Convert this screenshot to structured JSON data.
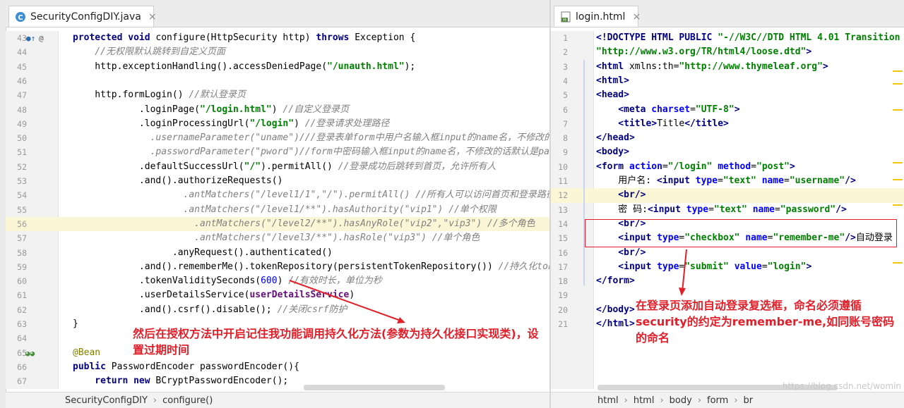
{
  "left_pane": {
    "tab": {
      "label": "SecurityConfigDIY.java",
      "close": "×"
    },
    "breadcrumb": [
      "SecurityConfigDIY",
      "configure()"
    ],
    "lines": [
      {
        "n": "43",
        "tokens": [
          [
            "kw",
            "protected void "
          ],
          [
            "",
            "configure(HttpSecurity http) "
          ],
          [
            "kw",
            "throws "
          ],
          [
            "",
            "Exception {"
          ]
        ]
      },
      {
        "n": "44",
        "tokens": [
          [
            "cm",
            "    //无权限默认跳转到自定义页面"
          ]
        ]
      },
      {
        "n": "45",
        "tokens": [
          [
            "",
            "    http.exceptionHandling().accessDeniedPage("
          ],
          [
            "str",
            "\"/unauth.html\""
          ],
          [
            "",
            ");"
          ]
        ]
      },
      {
        "n": "46",
        "tokens": []
      },
      {
        "n": "47",
        "tokens": [
          [
            "",
            "    http.formLogin() "
          ],
          [
            "cm",
            "//默认登录页"
          ]
        ]
      },
      {
        "n": "48",
        "tokens": [
          [
            "",
            "            .loginPage("
          ],
          [
            "str",
            "\"/login.html\""
          ],
          [
            "",
            ") "
          ],
          [
            "cm",
            "//自定义登录页"
          ]
        ]
      },
      {
        "n": "49",
        "tokens": [
          [
            "",
            "            .loginProcessingUrl("
          ],
          [
            "str",
            "\"/login\""
          ],
          [
            "",
            ") "
          ],
          [
            "cm",
            "//登录请求处理路径"
          ]
        ]
      },
      {
        "n": "50",
        "tokens": [
          [
            "cm",
            "              .usernameParameter(\"uname\")///登录表单form中用户名输入框input的name名，不修改的"
          ]
        ]
      },
      {
        "n": "51",
        "tokens": [
          [
            "cm",
            "              .passwordParameter(\"pword\")//form中密码输入框input的name名，不修改的话默认是pas"
          ]
        ]
      },
      {
        "n": "52",
        "tokens": [
          [
            "",
            "            .defaultSuccessUrl("
          ],
          [
            "str",
            "\"/\""
          ],
          [
            "",
            ").permitAll() "
          ],
          [
            "cm",
            "//登录成功后跳转到首页，允许所有人"
          ]
        ]
      },
      {
        "n": "53",
        "tokens": [
          [
            "",
            "            .and().authorizeRequests()"
          ]
        ]
      },
      {
        "n": "54",
        "tokens": [
          [
            "cm",
            "                    .antMatchers(\"/level1/1\",\"/\").permitAll() //所有人可以访问首页和登录路径"
          ]
        ]
      },
      {
        "n": "55",
        "tokens": [
          [
            "cm",
            "                    .antMatchers(\"/level1/**\").hasAuthority(\"vip1\") //单个权限"
          ]
        ]
      },
      {
        "n": "56",
        "tokens": [
          [
            "cm",
            "                      .antMatchers(\"/level2/**\").hasAnyRole(\"vip2\",\"vip3\") //多个角色"
          ]
        ]
      },
      {
        "n": "57",
        "tokens": [
          [
            "cm",
            "                      .antMatchers(\"/level3/**\").hasRole(\"vip3\") //单个角色"
          ]
        ]
      },
      {
        "n": "58",
        "tokens": [
          [
            "",
            "                  .anyRequest().authenticated()"
          ]
        ]
      },
      {
        "n": "59",
        "tokens": [
          [
            "",
            "            .and().rememberMe().tokenRepository(persistentTokenRepository()) "
          ],
          [
            "cm",
            "//持久化toke"
          ]
        ]
      },
      {
        "n": "60",
        "tokens": [
          [
            "",
            "            .tokenValiditySeconds("
          ],
          [
            "num",
            "600"
          ],
          [
            "",
            ") "
          ],
          [
            "cm",
            "//有效时长，单位为秒"
          ]
        ]
      },
      {
        "n": "61",
        "tokens": [
          [
            "",
            "            .userDetailsService("
          ],
          [
            "fld",
            "userDetailsService"
          ],
          [
            "",
            ")"
          ]
        ]
      },
      {
        "n": "62",
        "tokens": [
          [
            "",
            "            .and().csrf().disable(); "
          ],
          [
            "cm",
            "//关闭csrf防护"
          ]
        ]
      },
      {
        "n": "63",
        "tokens": [
          [
            "",
            "}"
          ]
        ]
      },
      {
        "n": "64",
        "tokens": []
      },
      {
        "n": "65",
        "tokens": [
          [
            "ann",
            "@Bean"
          ]
        ]
      },
      {
        "n": "66",
        "tokens": [
          [
            "kw",
            "public "
          ],
          [
            "",
            "PasswordEncoder passwordEncoder(){"
          ]
        ]
      },
      {
        "n": "67",
        "tokens": [
          [
            "kw",
            "    return new "
          ],
          [
            "",
            "BCryptPasswordEncoder();"
          ]
        ]
      }
    ],
    "annotation": "然后在授权方法中开启记住我功能调用持久化方法(参数为持久化接口实现类)，设置过期时间"
  },
  "right_pane": {
    "tab": {
      "label": "login.html",
      "close": "×"
    },
    "breadcrumb": [
      "html",
      "html",
      "body",
      "form",
      "br"
    ],
    "lines": [
      {
        "n": "1",
        "tokens": [
          [
            "tag",
            "<!DOCTYPE HTML PUBLIC "
          ],
          [
            "str",
            "\"-//W3C//DTD HTML 4.01 Transition"
          ]
        ]
      },
      {
        "n": "2",
        "tokens": [
          [
            "str",
            "\"http://www.w3.org/TR/html4/loose.dtd\""
          ],
          [
            "tag",
            ">"
          ]
        ]
      },
      {
        "n": "3",
        "tokens": [
          [
            "tag",
            "<html "
          ],
          [
            "",
            "xmlns:th="
          ],
          [
            "str",
            "\"http://www.thymeleaf.org\""
          ],
          [
            "tag",
            ">"
          ]
        ]
      },
      {
        "n": "4",
        "tokens": [
          [
            "tag",
            "<html>"
          ]
        ]
      },
      {
        "n": "5",
        "tokens": [
          [
            "tag",
            "<head>"
          ]
        ]
      },
      {
        "n": "6",
        "tokens": [
          [
            "tag",
            "    <meta "
          ],
          [
            "attr",
            "charset"
          ],
          [
            "",
            "="
          ],
          [
            "str",
            "\"UTF-8\""
          ],
          [
            "tag",
            ">"
          ]
        ]
      },
      {
        "n": "7",
        "tokens": [
          [
            "tag",
            "    <title>"
          ],
          [
            "",
            "Title"
          ],
          [
            "tag",
            "</title>"
          ]
        ]
      },
      {
        "n": "8",
        "tokens": [
          [
            "tag",
            "</head>"
          ]
        ]
      },
      {
        "n": "9",
        "tokens": [
          [
            "tag",
            "<body>"
          ]
        ]
      },
      {
        "n": "10",
        "tokens": [
          [
            "tag",
            "<form "
          ],
          [
            "attr",
            "action"
          ],
          [
            "",
            "="
          ],
          [
            "str",
            "\"/login\" "
          ],
          [
            "attr",
            "method"
          ],
          [
            "",
            "="
          ],
          [
            "str",
            "\"post\""
          ],
          [
            "tag",
            ">"
          ]
        ]
      },
      {
        "n": "11",
        "tokens": [
          [
            "",
            "    用户名: "
          ],
          [
            "tag",
            "<input "
          ],
          [
            "attr",
            "type"
          ],
          [
            "",
            "="
          ],
          [
            "str",
            "\"text\" "
          ],
          [
            "attr",
            "name"
          ],
          [
            "",
            "="
          ],
          [
            "str",
            "\"username\""
          ],
          [
            "tag",
            "/>"
          ]
        ]
      },
      {
        "n": "12",
        "tokens": [
          [
            "tag",
            "    <br/>"
          ]
        ]
      },
      {
        "n": "13",
        "tokens": [
          [
            "",
            "    密 码:"
          ],
          [
            "tag",
            "<input "
          ],
          [
            "attr",
            "type"
          ],
          [
            "",
            "="
          ],
          [
            "str",
            "\"text\" "
          ],
          [
            "attr",
            "name"
          ],
          [
            "",
            "="
          ],
          [
            "str",
            "\"password\""
          ],
          [
            "tag",
            "/>"
          ]
        ]
      },
      {
        "n": "14",
        "tokens": [
          [
            "tag",
            "    <br/>"
          ]
        ]
      },
      {
        "n": "15",
        "tokens": [
          [
            "tag",
            "    <input "
          ],
          [
            "attr",
            "type"
          ],
          [
            "",
            "="
          ],
          [
            "str",
            "\"checkbox\" "
          ],
          [
            "attr",
            "name"
          ],
          [
            "",
            "="
          ],
          [
            "str",
            "\"remember-me\""
          ],
          [
            "tag",
            "/>"
          ],
          [
            "",
            "自动登录"
          ]
        ]
      },
      {
        "n": "16",
        "tokens": [
          [
            "tag",
            "    <br/>"
          ]
        ]
      },
      {
        "n": "17",
        "tokens": [
          [
            "tag",
            "    <input "
          ],
          [
            "attr",
            "type"
          ],
          [
            "",
            "="
          ],
          [
            "str",
            "\"submit\" "
          ],
          [
            "attr",
            "value"
          ],
          [
            "",
            "="
          ],
          [
            "str",
            "\"login\""
          ],
          [
            "tag",
            ">"
          ]
        ]
      },
      {
        "n": "18",
        "tokens": [
          [
            "tag",
            "</form>"
          ]
        ]
      },
      {
        "n": "19",
        "tokens": []
      },
      {
        "n": "20",
        "tokens": [
          [
            "tag",
            "</body>"
          ]
        ]
      },
      {
        "n": "21",
        "tokens": [
          [
            "tag",
            "</html>"
          ]
        ]
      }
    ],
    "annotation": "在登录页添加自动登录复选框，命名必须遵循security的约定为remember-me,如同账号密码的命名"
  },
  "watermark": "https://blog.csdn.net/womin",
  "colors": {
    "annotation": "#e0202a",
    "keyword": "#000080",
    "string": "#008000",
    "comment": "#808080"
  }
}
